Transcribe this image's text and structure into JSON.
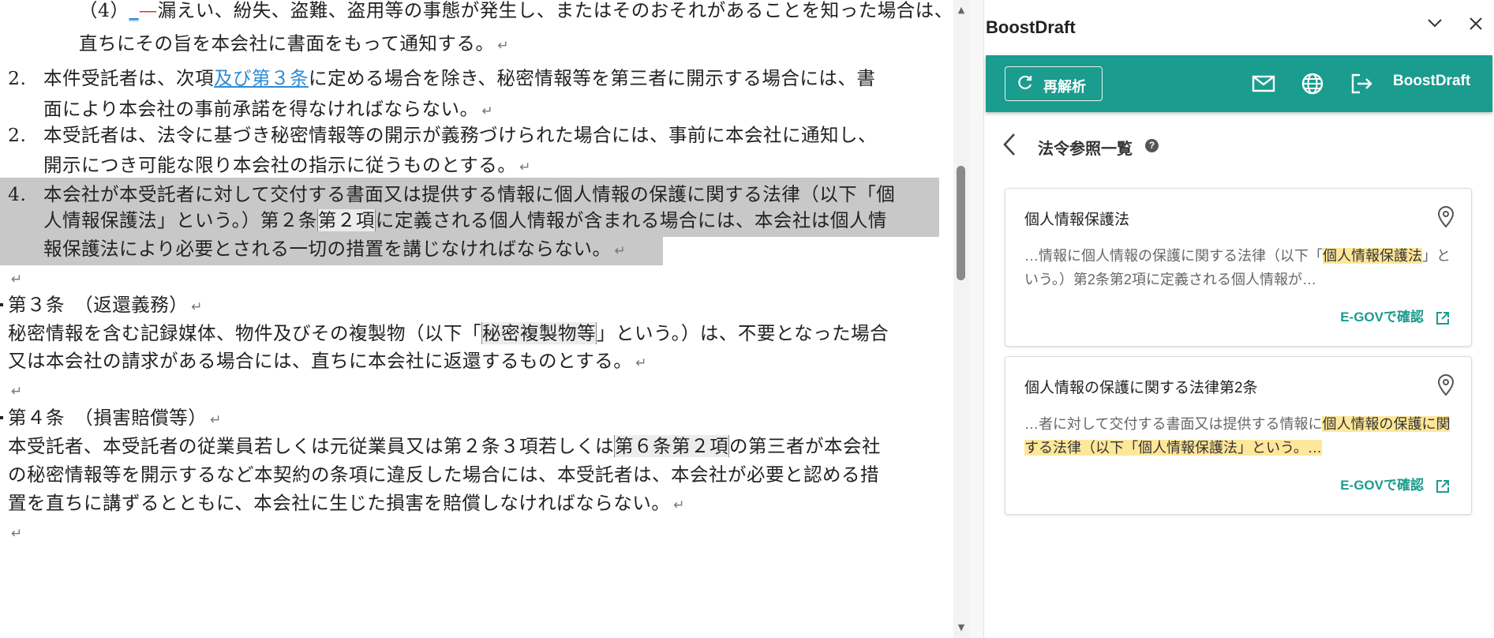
{
  "document": {
    "lines": [
      {
        "segments": [
          {
            "t": "（4）"
          },
          {
            "t": "_",
            "c": "link"
          },
          {
            "t": "—",
            "c": "red"
          },
          {
            "t": "漏えい、紛失、盗難、盗用等の事態が発生し、またはそのおそれがあることを知った場合は、"
          }
        ],
        "ret": false
      },
      {
        "segments": [
          {
            "t": "直ちにその旨を本会社に書面をもって通知する。"
          }
        ],
        "ret": true
      },
      {
        "num": "2.",
        "segments": [
          {
            "t": "本件受託者は、次項"
          },
          {
            "t": "及び第３条",
            "c": "link"
          },
          {
            "t": "に定める場合を除き、秘密情報等を第三者に開示する場合には、書"
          }
        ],
        "ret": false
      },
      {
        "segments": [
          {
            "t": "面により本会社の事前承諾を得なければならない。"
          }
        ],
        "ret": true
      },
      {
        "num": "2.",
        "segments": [
          {
            "t": "本受託者は、法令に基づき秘密情報等の開示が義務づけられた場合には、事前に本会社に通知し、"
          }
        ],
        "ret": false
      },
      {
        "segments": [
          {
            "t": "開示につき可能な限り本会社の指示に従うものとする。"
          }
        ],
        "ret": true
      },
      {
        "num": "4.",
        "segments": [
          {
            "t": "本会社が本受託者に対して交付する書面又は提供する情報に個人情報の保護に関する法律（以下「個"
          }
        ],
        "ret": false
      },
      {
        "segments": [
          {
            "t": "人情報保護法」という。）第２条"
          },
          {
            "t": "第２項",
            "c": "fieldbox"
          },
          {
            "t": "に定義される個人情報が含まれる場合には、本会社は個人情"
          }
        ],
        "ret": false
      },
      {
        "segments": [
          {
            "t": "報保護法により必要とされる一切の措置を講じなければならない。"
          }
        ],
        "ret": true
      },
      {
        "segments": [],
        "ret": true
      },
      {
        "segments": [
          {
            "t": "第３条　（返還義務）"
          }
        ],
        "ret": true
      },
      {
        "segments": [
          {
            "t": "秘密情報を含む記録媒体、物件及びその複製物（以下「"
          },
          {
            "t": "秘密複製物等",
            "c": "fieldbox"
          },
          {
            "t": "」という。）は、不要となった場合"
          }
        ],
        "ret": false
      },
      {
        "segments": [
          {
            "t": "又は本会社の請求がある場合には、直ちに本会社に返還するものとする。"
          }
        ],
        "ret": true
      },
      {
        "segments": [],
        "ret": true
      },
      {
        "segments": [
          {
            "t": "第４条　（損害賠償等）"
          }
        ],
        "ret": true
      },
      {
        "segments": [
          {
            "t": "本受託者、本受託者の従業員若しくは元従業員又は第２条３項若しくは"
          },
          {
            "t": "第６条第２項",
            "c": "fieldbox"
          },
          {
            "t": "の第三者が本会社"
          }
        ],
        "ret": false
      },
      {
        "segments": [
          {
            "t": "の秘密情報等を開示するなど本契約の条項に違反した場合には、本受託者は、本会社が必要と認める措"
          }
        ],
        "ret": false
      },
      {
        "segments": [
          {
            "t": "置を直ちに講ずるとともに、本会社に生じた損害を賠償しなければならない。"
          }
        ],
        "ret": true
      },
      {
        "segments": [],
        "ret": true
      }
    ],
    "return_mark": "↵"
  },
  "panel": {
    "title": "BoostDraft",
    "reanalyze_label": "再解析",
    "brand_label": "BoostDraft",
    "section_title": "法令参照一覧",
    "help_glyph": "?",
    "accent_color": "#1a9c8e",
    "highlight_color": "#fde79a",
    "cards": [
      {
        "title": "個人情報保護法",
        "snippet": [
          {
            "t": "…情報に個人情報の保護に関する法律（以下「"
          },
          {
            "t": "個人情報保護法",
            "h": true
          },
          {
            "t": "」という。）第2条第2項に定義される個人情報が…"
          }
        ],
        "link": "E-GOVで確認"
      },
      {
        "title": "個人情報の保護に関する法律第2条",
        "snippet": [
          {
            "t": "…者に対して交付する書面又は提供する情報に"
          },
          {
            "t": "個人情報の保護に関する法律（以下「個人情報保護法」という。…",
            "h": true
          }
        ],
        "link": "E-GOVで確認"
      }
    ]
  }
}
